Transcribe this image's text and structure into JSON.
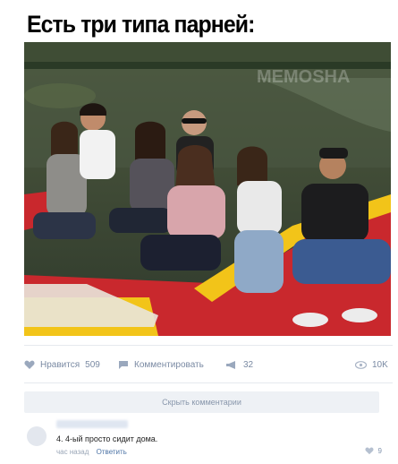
{
  "headline": "Есть три типа парней:",
  "photo": {
    "watermark": "MEMOSHA"
  },
  "actions": {
    "like_label": "Нравится",
    "like_count": "509",
    "comment_label": "Комментировать",
    "share_count": "32",
    "views": "10K"
  },
  "hide_comments": "Скрыть комментарии",
  "comment": {
    "text": "4. 4-ый просто сидит дома.",
    "time": "час назад",
    "reply": "Ответить",
    "likes": "9"
  },
  "colors": {
    "link": "#4d74a6",
    "muted": "#7a8aa3",
    "boat_red": "#c9282d",
    "boat_yellow": "#f2c419"
  }
}
